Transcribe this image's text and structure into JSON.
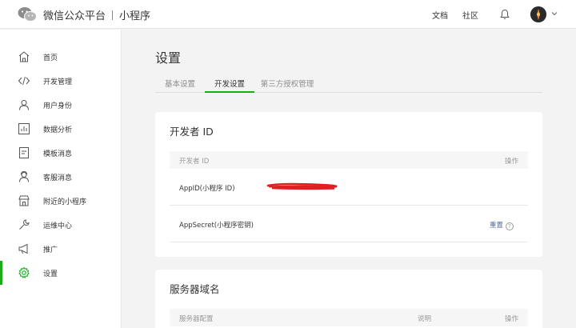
{
  "header": {
    "brand_title": "微信公众平台",
    "brand_sub": "小程序",
    "links": {
      "docs": "文档",
      "community": "社区"
    }
  },
  "sidebar": {
    "items": [
      {
        "label": "首页",
        "icon": "home-icon"
      },
      {
        "label": "开发管理",
        "icon": "code-icon"
      },
      {
        "label": "用户身份",
        "icon": "user-icon"
      },
      {
        "label": "数据分析",
        "icon": "chart-icon"
      },
      {
        "label": "模板消息",
        "icon": "document-icon"
      },
      {
        "label": "客服消息",
        "icon": "headset-user-icon"
      },
      {
        "label": "附近的小程序",
        "icon": "store-icon"
      },
      {
        "label": "运维中心",
        "icon": "wrench-icon"
      },
      {
        "label": "推广",
        "icon": "megaphone-icon"
      },
      {
        "label": "设置",
        "icon": "gear-icon",
        "active": true
      }
    ]
  },
  "main": {
    "title": "设置",
    "tabs": [
      {
        "label": "基本设置"
      },
      {
        "label": "开发设置",
        "active": true
      },
      {
        "label": "第三方授权管理"
      }
    ],
    "developer_card": {
      "title": "开发者 ID",
      "columns": {
        "name": "开发者 ID",
        "action": "操作"
      },
      "rows": [
        {
          "key": "AppID(小程序 ID)"
        },
        {
          "key": "AppSecret(小程序密钥)",
          "action": "重置",
          "help": "?"
        }
      ]
    },
    "server_card": {
      "title": "服务器域名",
      "columns": {
        "name": "服务器配置",
        "desc": "说明",
        "action": "操作"
      }
    }
  },
  "colors": {
    "accent": "#1aad19",
    "link": "#576b95",
    "redaction": "#e02020"
  }
}
